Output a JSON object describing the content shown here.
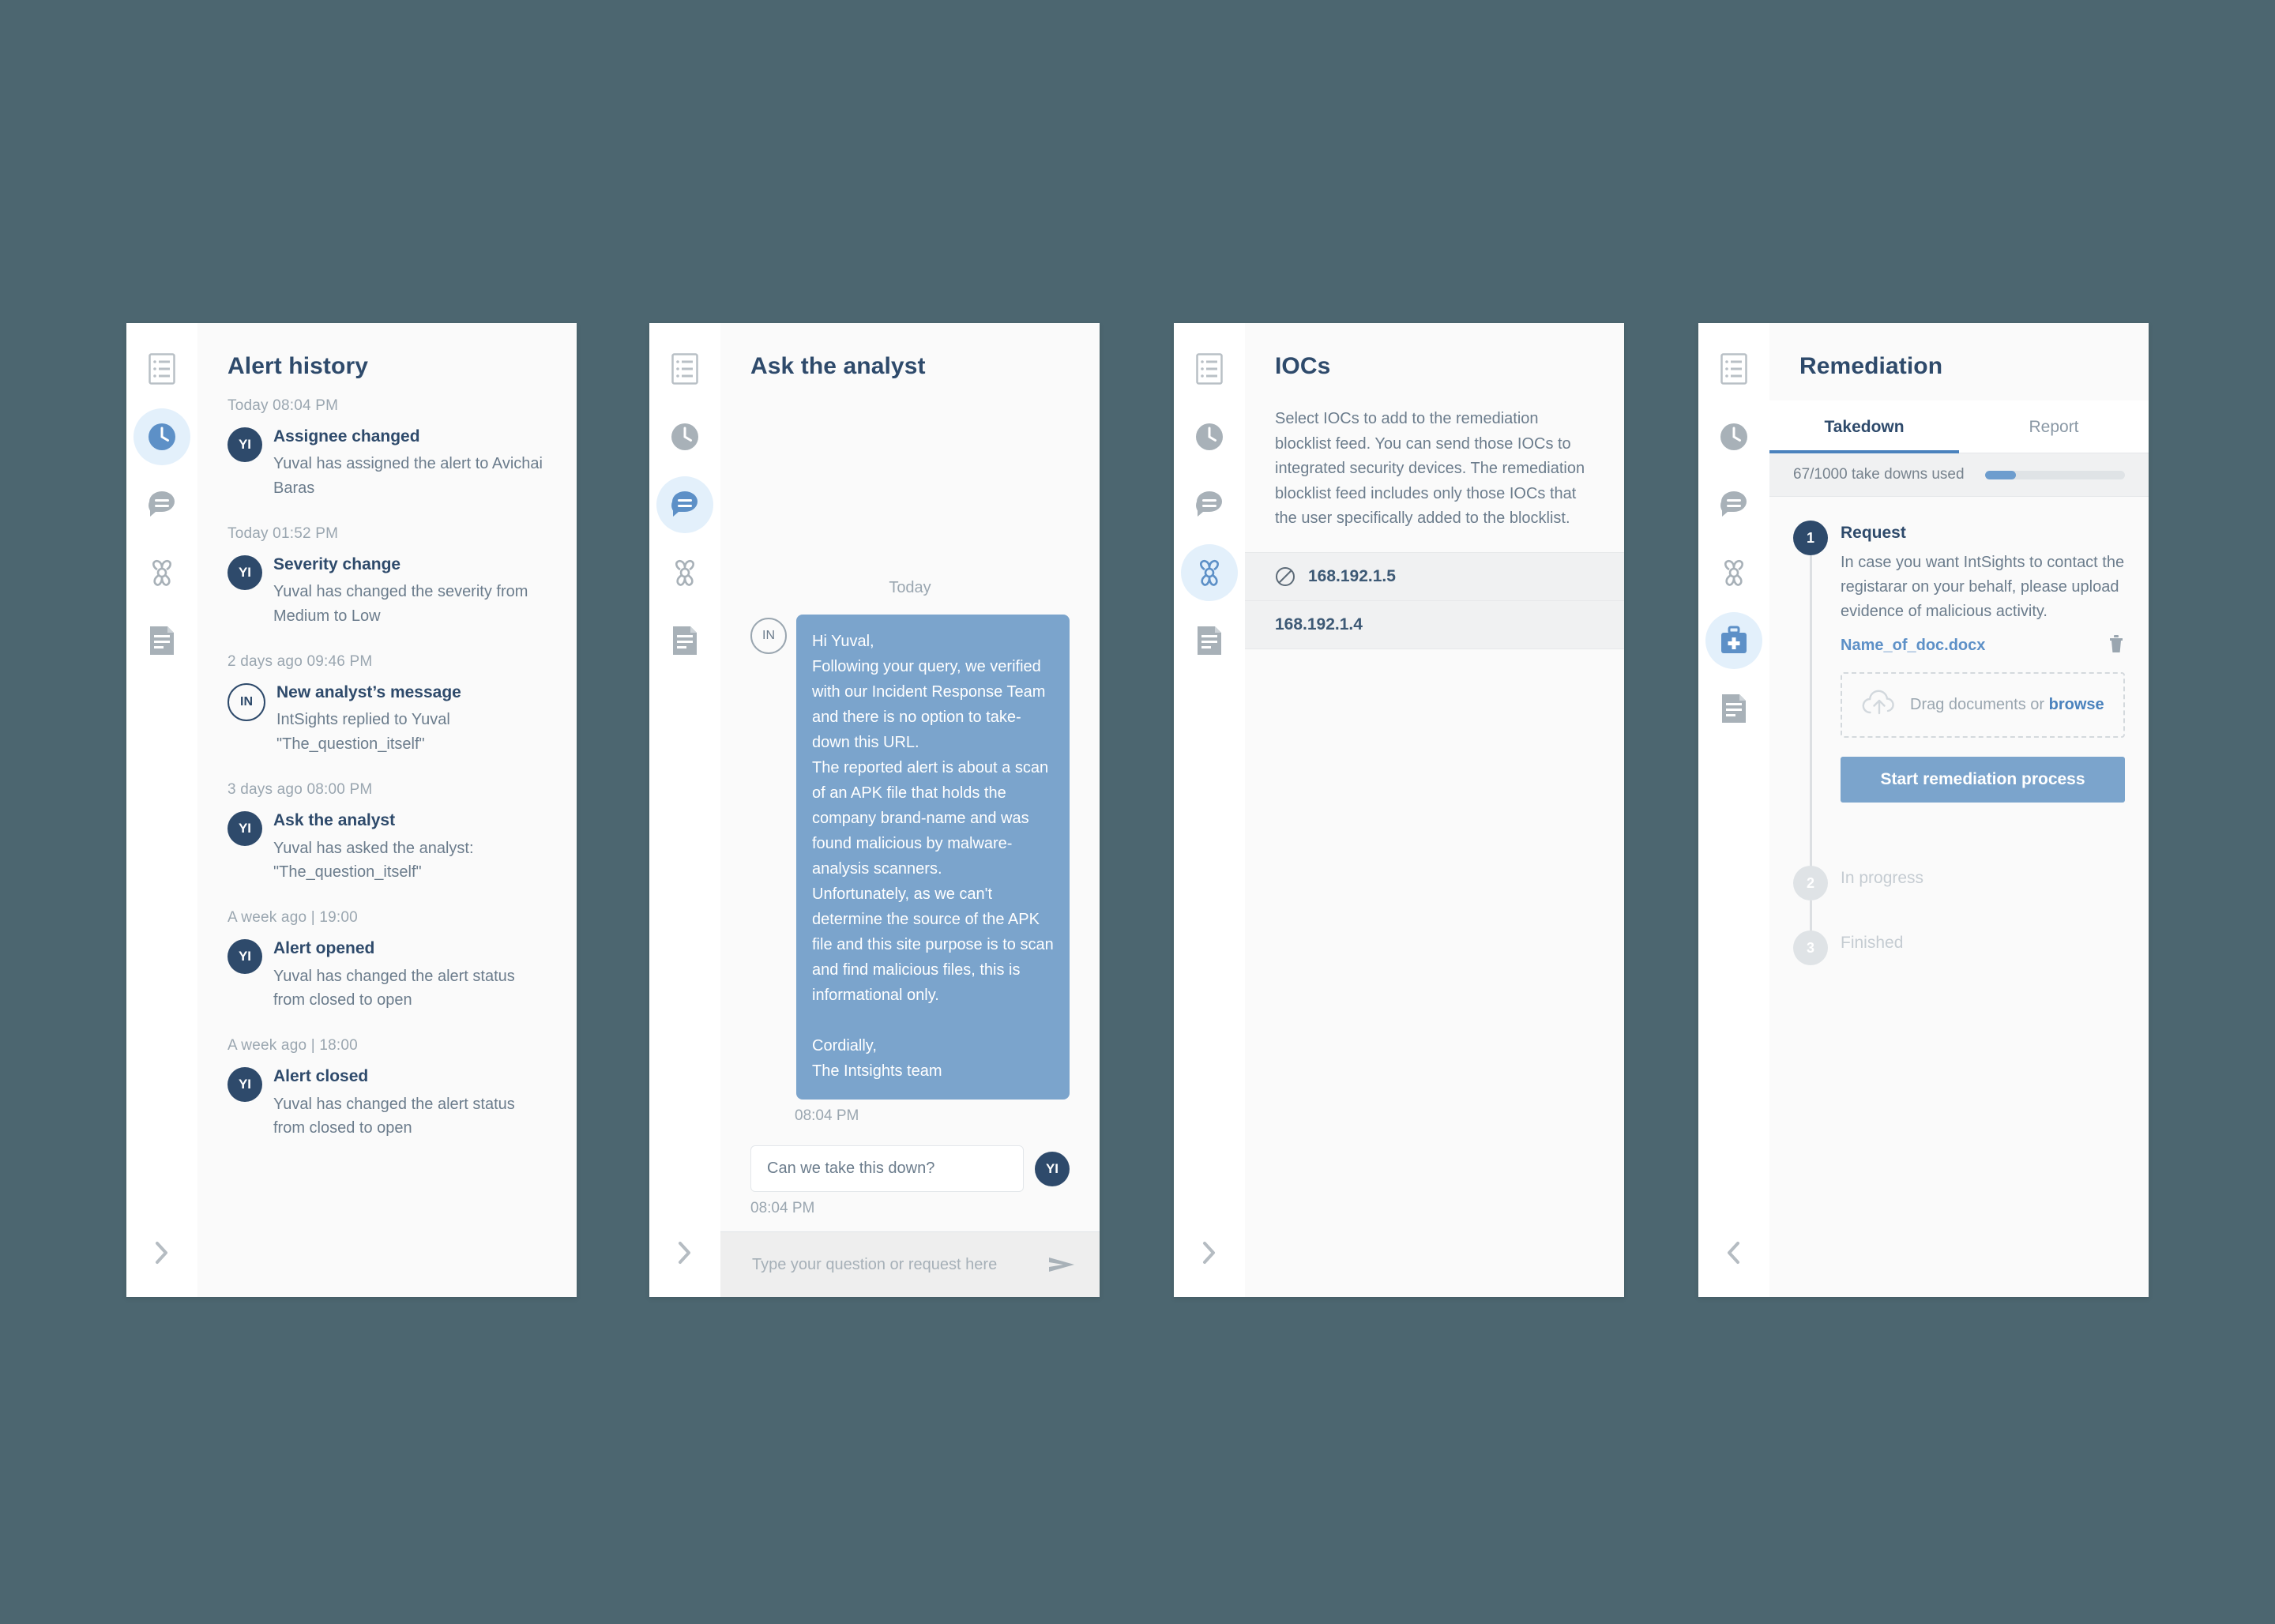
{
  "theme": {
    "page_background": "#4c6670",
    "panel_background": "#fafafa",
    "rail_background": "#ffffff",
    "accent_blue": "#4a82bd",
    "bubble_blue": "#7ba4cc",
    "active_icon_blue": "#5d90c7",
    "active_pill": "#e3f0fb",
    "muted_icon": "#a8b1b8",
    "title_navy": "#2e4a6b",
    "body_gray": "#6b7c8c",
    "meta_gray": "#9aa6b0"
  },
  "rail": {
    "icons": [
      {
        "name": "alert-details-icon",
        "label": "Alert details"
      },
      {
        "name": "clock-history-icon",
        "label": "Alert history"
      },
      {
        "name": "chat-bubble-icon",
        "label": "Ask the analyst"
      },
      {
        "name": "biohazard-iocs-icon",
        "label": "IOCs"
      },
      {
        "name": "medical-kit-remediation-icon",
        "label": "Remediation"
      },
      {
        "name": "report-document-icon",
        "label": "Report"
      }
    ],
    "collapse_chevron_right": "›",
    "collapse_chevron_left": "‹"
  },
  "panels": [
    {
      "id": "alert-history",
      "title": "Alert history",
      "active_rail_icon": "clock-history-icon",
      "rail_icon_count": 5,
      "chevron": "right",
      "events": [
        {
          "time": "Today  08:04 PM",
          "avatar": "YI",
          "avatar_style": "filled",
          "headline": "Assignee changed",
          "description": "Yuval has assigned the alert to Avichai Baras"
        },
        {
          "time": "Today  01:52 PM",
          "avatar": "YI",
          "avatar_style": "filled",
          "headline": "Severity change",
          "description": "Yuval has changed the severity from Medium to Low"
        },
        {
          "time": "2 days ago  09:46 PM",
          "avatar": "IN",
          "avatar_style": "outline",
          "headline": "New analyst’s message",
          "description": "IntSights replied to Yuval\n\"The_question_itself\""
        },
        {
          "time": "3 days ago 08:00 PM",
          "avatar": "YI",
          "avatar_style": "filled",
          "headline": "Ask the analyst",
          "description": "Yuval has asked the analyst:\n\"The_question_itself\""
        },
        {
          "time": "A week ago | 19:00",
          "avatar": "YI",
          "avatar_style": "filled",
          "headline": "Alert opened",
          "description": "Yuval has changed the alert status from closed to open"
        },
        {
          "time": "A week ago | 18:00",
          "avatar": "YI",
          "avatar_style": "filled",
          "headline": "Alert closed",
          "description": "Yuval has changed the alert status from closed to open"
        }
      ]
    },
    {
      "id": "ask-the-analyst",
      "title": "Ask the analyst",
      "active_rail_icon": "chat-bubble-icon",
      "rail_icon_count": 5,
      "chevron": "right",
      "day_separator": "Today",
      "incoming": {
        "avatar": "IN",
        "text": "Hi Yuval,\nFollowing your query, we verified with our Incident Response Team and there is no option to take-down this URL.\nThe reported alert is about a scan of an APK file that holds the company brand-name and was found malicious by malware-analysis scanners.\nUnfortunately, as we can't determine the source of the APK file and this site purpose is to scan and find malicious files, this is informational only.\n\nCordially,\nThe Intsights team",
        "timestamp": "08:04 PM"
      },
      "outgoing": {
        "avatar": "YI",
        "text": "Can we take this down?",
        "timestamp": "08:04 PM"
      },
      "composer": {
        "placeholder": "Type your question or request here",
        "value": "",
        "send_icon": "send-paper-plane-icon"
      }
    },
    {
      "id": "iocs",
      "title": "IOCs",
      "active_rail_icon": "biohazard-iocs-icon",
      "rail_icon_count": 5,
      "chevron": "right",
      "description": "Select IOCs to add to the remediation blocklist feed. You can send those IOCs to integrated security devices. The remediation blocklist feed includes only those IOCs that the user specifically added to the blocklist.",
      "rows": [
        {
          "value": "168.192.1.5",
          "icon": "blocked-circle-slash-icon",
          "has_icon": true
        },
        {
          "value": "168.192.1.4",
          "icon": "",
          "has_icon": false
        }
      ]
    },
    {
      "id": "remediation",
      "title": "Remediation",
      "active_rail_icon": "medical-kit-remediation-icon",
      "rail_icon_count": 6,
      "chevron": "left",
      "tabs": [
        {
          "label": "Takedown",
          "active": true
        },
        {
          "label": "Report",
          "active": false
        }
      ],
      "quota": {
        "label": "67/1000 take downs used",
        "used": 67,
        "total": 1000,
        "percent": 22
      },
      "steps": [
        {
          "number": "1",
          "title": "Request",
          "state": "active",
          "description": "In case you want IntSights to contact the registarar on your behalf, please upload evidence of malicious activity.",
          "file": {
            "name": "Name_of_doc.docx",
            "delete_icon": "trash-icon"
          },
          "dropzone": {
            "icon": "cloud-upload-icon",
            "text": "Drag documents or ",
            "link": "browse"
          },
          "button": "Start remediation process"
        },
        {
          "number": "2",
          "title": "In progress",
          "state": "muted"
        },
        {
          "number": "3",
          "title": "Finished",
          "state": "muted"
        }
      ]
    }
  ]
}
